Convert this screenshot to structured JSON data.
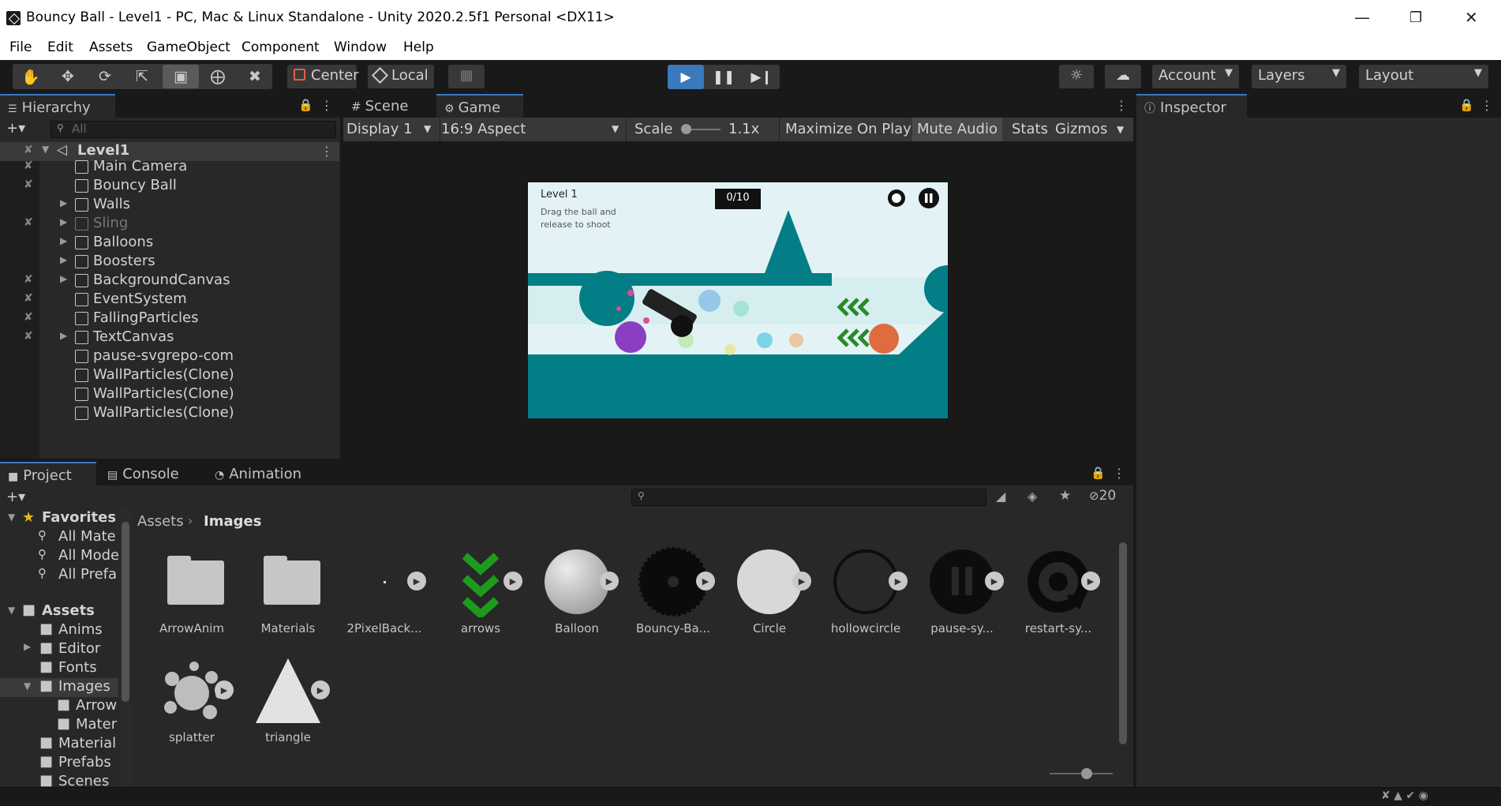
{
  "window": {
    "title": "Bouncy Ball - Level1 - PC, Mac & Linux Standalone - Unity 2020.2.5f1 Personal <DX11>"
  },
  "menu": [
    "File",
    "Edit",
    "Assets",
    "GameObject",
    "Component",
    "Window",
    "Help"
  ],
  "toolbar": {
    "pivot_label": "Center",
    "space_label": "Local",
    "account_label": "Account",
    "layers_label": "Layers",
    "layout_label": "Layout"
  },
  "hierarchy": {
    "tab": "Hierarchy",
    "search_placeholder": "All",
    "scene": "Level1",
    "items": [
      {
        "label": "Main Camera"
      },
      {
        "label": "Bouncy Ball"
      },
      {
        "label": "Walls"
      },
      {
        "label": "Sling"
      },
      {
        "label": "Balloons"
      },
      {
        "label": "Boosters"
      },
      {
        "label": "BackgroundCanvas"
      },
      {
        "label": "EventSystem"
      },
      {
        "label": "FallingParticles"
      },
      {
        "label": "TextCanvas"
      },
      {
        "label": "pause-svgrepo-com"
      },
      {
        "label": "WallParticles(Clone)"
      },
      {
        "label": "WallParticles(Clone)"
      },
      {
        "label": "WallParticles(Clone)"
      }
    ]
  },
  "center_tabs": {
    "scene": "Scene",
    "game": "Game"
  },
  "game_toolbar": {
    "display": "Display 1",
    "aspect": "16:9 Aspect",
    "scale_label": "Scale",
    "scale_value": "1.1x",
    "maximize": "Maximize On Play",
    "mute": "Mute Audio",
    "stats": "Stats",
    "gizmos": "Gizmos"
  },
  "game": {
    "level": "Level 1",
    "hint": "Drag the ball and\nrelease to shoot",
    "counter": "0/10"
  },
  "inspector": {
    "tab": "Inspector"
  },
  "bottom_tabs": {
    "project": "Project",
    "console": "Console",
    "animation": "Animation"
  },
  "project": {
    "hidden_count": "20",
    "breadcrumb": [
      "Assets",
      "Images"
    ],
    "favorites_label": "Favorites",
    "favorites": [
      "All Mate",
      "All Mode",
      "All Prefa"
    ],
    "assets_label": "Assets",
    "tree": [
      "Anims",
      "Editor",
      "Fonts",
      "Images",
      "Arrow",
      "Mater",
      "Material",
      "Prefabs",
      "Scenes"
    ],
    "items": [
      {
        "label": "ArrowAnim",
        "kind": "folder"
      },
      {
        "label": "Materials",
        "kind": "folder"
      },
      {
        "label": "2PixelBack...",
        "kind": "dot"
      },
      {
        "label": "arrows",
        "kind": "arrows"
      },
      {
        "label": "Balloon",
        "kind": "balloon"
      },
      {
        "label": "Bouncy-Ba...",
        "kind": "saw"
      },
      {
        "label": "Circle",
        "kind": "circle"
      },
      {
        "label": "hollowcircle",
        "kind": "hollow"
      },
      {
        "label": "pause-sy...",
        "kind": "pause"
      },
      {
        "label": "restart-sy...",
        "kind": "restart"
      },
      {
        "label": "splatter",
        "kind": "splatter"
      },
      {
        "label": "triangle",
        "kind": "triangle"
      }
    ]
  },
  "colors": {
    "accent": "#3a79bb",
    "teal": "#047e86",
    "editor_bg": "#282828"
  }
}
